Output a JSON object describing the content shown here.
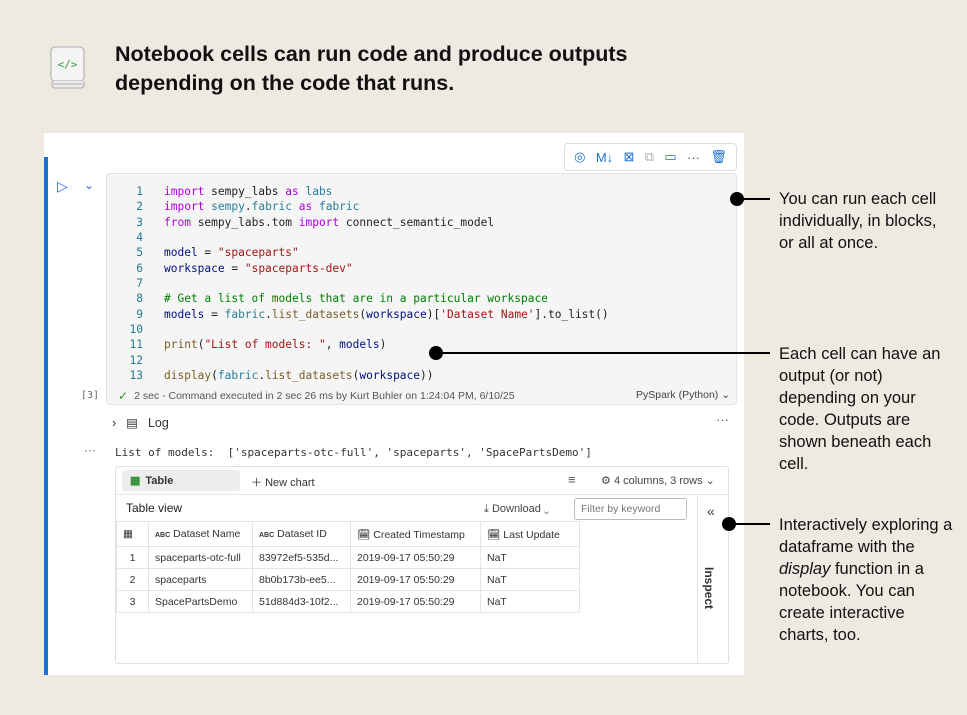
{
  "header": {
    "title": "Notebook cells can run code and produce outputs depending on the code that runs.",
    "icon": "notebook-code-icon"
  },
  "cell_toolbar": {
    "icons": [
      "copilot-icon",
      "markdown-icon",
      "clear-output-icon",
      "copy-icon",
      "comment-icon",
      "more-icon",
      "delete-icon"
    ],
    "markdown_label": "M↓",
    "more_label": "···"
  },
  "cell": {
    "exec_count": "[3]",
    "code": [
      [
        [
          "import ",
          "kw"
        ],
        [
          "sempy_labs ",
          "pl"
        ],
        [
          "as ",
          "kw"
        ],
        [
          "labs",
          "md"
        ]
      ],
      [
        [
          "import ",
          "kw"
        ],
        [
          "sempy",
          "md"
        ],
        [
          ".",
          "pl"
        ],
        [
          "fabric ",
          "md"
        ],
        [
          "as ",
          "kw"
        ],
        [
          "fabric",
          "md"
        ]
      ],
      [
        [
          "from ",
          "kw"
        ],
        [
          "sempy_labs.tom ",
          "pl"
        ],
        [
          "import ",
          "kw"
        ],
        [
          "connect_semantic_model",
          "pl"
        ]
      ],
      [],
      [
        [
          "model",
          "vr"
        ],
        [
          " = ",
          "pl"
        ],
        [
          "\"spaceparts\"",
          "st"
        ]
      ],
      [
        [
          "workspace",
          "vr"
        ],
        [
          " = ",
          "pl"
        ],
        [
          "\"spaceparts-dev\"",
          "st"
        ]
      ],
      [],
      [
        [
          "# Get a list of models that are in a particular workspace",
          "cm"
        ]
      ],
      [
        [
          "models",
          "vr"
        ],
        [
          " = ",
          "pl"
        ],
        [
          "fabric",
          "md"
        ],
        [
          ".",
          "pl"
        ],
        [
          "list_datasets",
          "fn"
        ],
        [
          "(",
          "pl"
        ],
        [
          "workspace",
          "vr"
        ],
        [
          ")[",
          "pl"
        ],
        [
          "'Dataset Name'",
          "st"
        ],
        [
          "].to_list()",
          "pl"
        ]
      ],
      [],
      [
        [
          "print",
          "fn"
        ],
        [
          "(",
          "pl"
        ],
        [
          "\"List of models: \"",
          "st"
        ],
        [
          ", ",
          "pl"
        ],
        [
          "models",
          "vr"
        ],
        [
          ")",
          "pl"
        ]
      ],
      [],
      [
        [
          "display",
          "fn"
        ],
        [
          "(",
          "pl"
        ],
        [
          "fabric",
          "md"
        ],
        [
          ".",
          "pl"
        ],
        [
          "list_datasets",
          "fn"
        ],
        [
          "(",
          "pl"
        ],
        [
          "workspace",
          "vr"
        ],
        [
          "))",
          "pl"
        ]
      ]
    ],
    "status_check": "✓",
    "status": "2 sec - Command executed in 2 sec 26 ms by Kurt Buhler on 1:24:04 PM, 6/10/25",
    "language": "PySpark (Python)"
  },
  "output": {
    "log_label": "Log",
    "print_text": "List of models:  ['spaceparts-otc-full', 'spaceparts', 'SpacePartsDemo']",
    "table_tab": "Table",
    "new_chart": "New chart",
    "cols_rows": "4 columns, 3 rows",
    "table_view": "Table view",
    "download": "Download",
    "filter_placeholder": "Filter by keyword",
    "inspect": "Inspect",
    "columns": [
      "Dataset Name",
      "Dataset ID",
      "Created Timestamp",
      "Last Update"
    ],
    "column_types": [
      "ABC",
      "ABC",
      "datetime",
      "datetime"
    ],
    "type_abc": "ABC",
    "rows": [
      [
        "1",
        "spaceparts-otc-full",
        "83972ef5-535d...",
        "2019-09-17 05:50:29",
        "NaT"
      ],
      [
        "2",
        "spaceparts",
        "8b0b173b-ee5...",
        "2019-09-17 05:50:29",
        "NaT"
      ],
      [
        "3",
        "SpacePartsDemo",
        "51d884d3-10f2...",
        "2019-09-17 05:50:29",
        "NaT"
      ]
    ]
  },
  "annotations": [
    "You can run each cell individually, in blocks, or all at once.",
    "Each cell can have an output (or not) depending on your code. Outputs are shown beneath each cell.",
    {
      "pre": "Interactively exploring a dataframe with the ",
      "em": "display",
      "post": " function in a notebook. You can create interactive charts, too."
    }
  ],
  "colors": {
    "accent": "#1a6fd4",
    "background": "#eee9e1"
  }
}
